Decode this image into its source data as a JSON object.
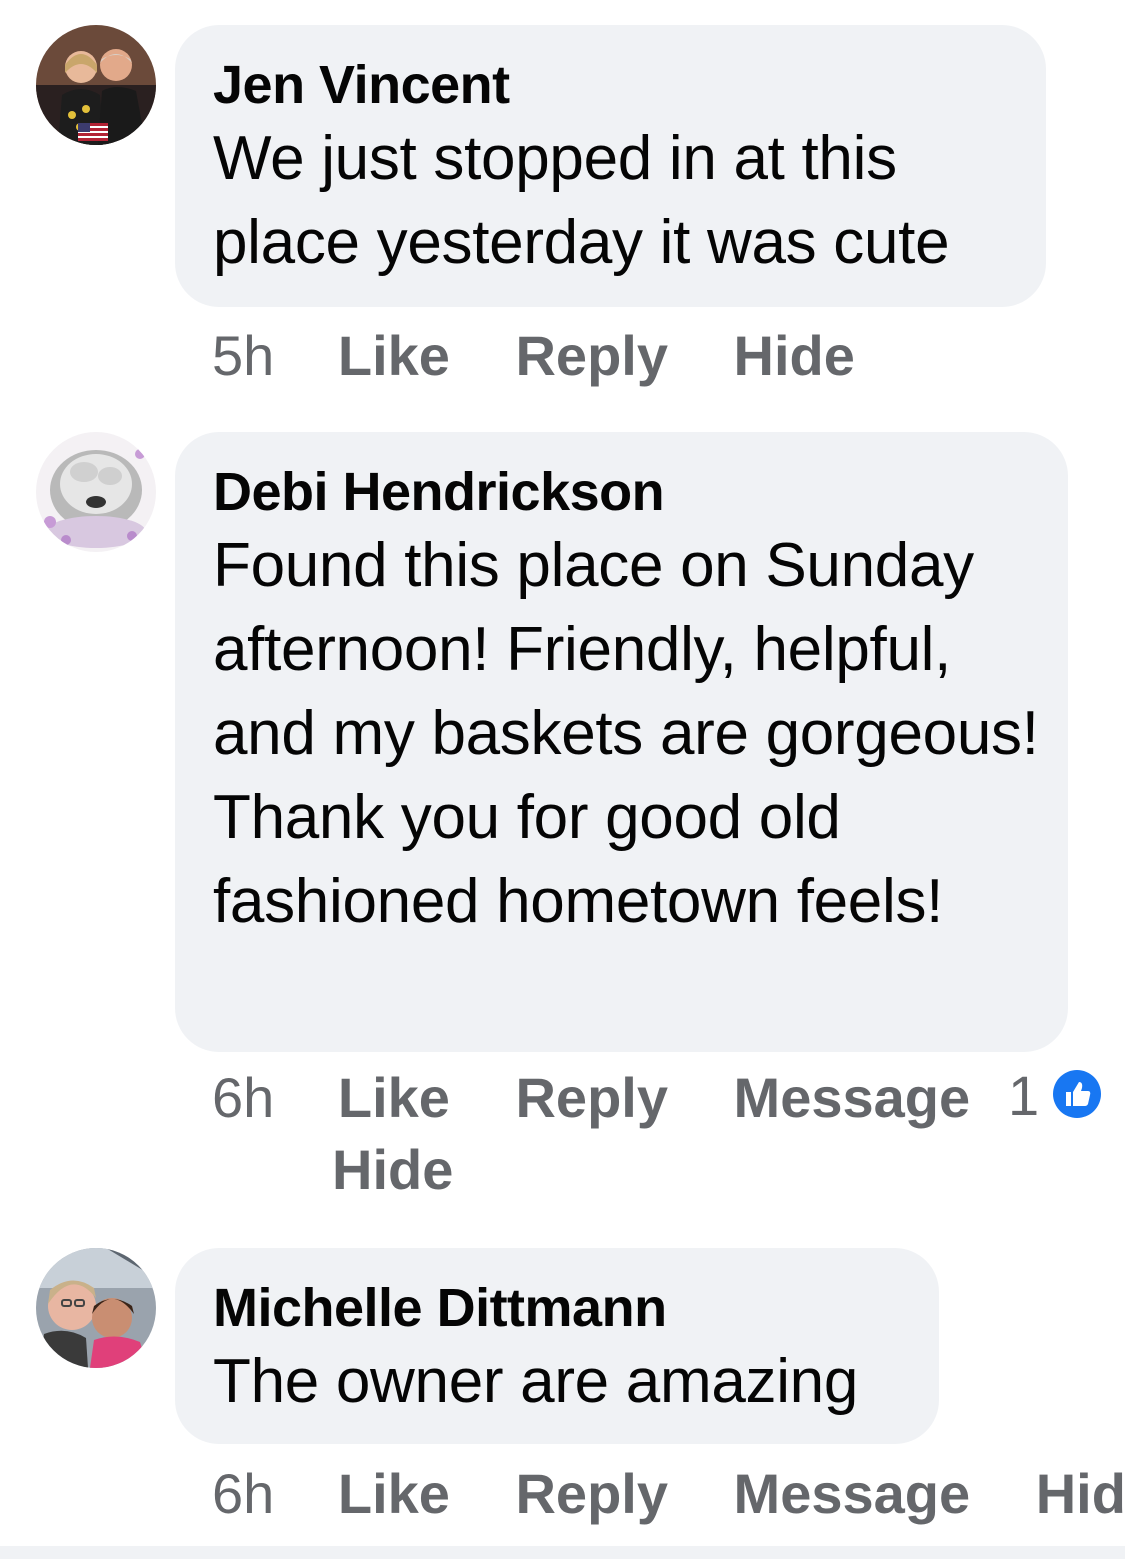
{
  "comments": [
    {
      "author": "Jen Vincent",
      "text": "We just stopped in at this place yesterday it was cute",
      "time": "5h",
      "actions": {
        "like": "Like",
        "reply": "Reply",
        "hide": "Hide"
      }
    },
    {
      "author": "Debi Hendrickson",
      "text": "Found this place on Sunday afternoon! Friendly, helpful, and my baskets are gorgeous! Thank you for good old fashioned hometown feels!",
      "time": "6h",
      "actions": {
        "like": "Like",
        "reply": "Reply",
        "message": "Message",
        "hide": "Hide"
      },
      "reaction_count": "1",
      "reaction_icon": "thumbs-up-icon",
      "reaction_color": "#1877f2"
    },
    {
      "author": "Michelle Dittmann",
      "text": "The owner are amazing",
      "time": "6h",
      "actions": {
        "like": "Like",
        "reply": "Reply",
        "message": "Message",
        "hide": "Hide"
      }
    }
  ],
  "colors": {
    "bubble": "#f0f2f5",
    "meta_text": "#65676b",
    "body_text": "#050505",
    "like_blue": "#1877f2"
  }
}
